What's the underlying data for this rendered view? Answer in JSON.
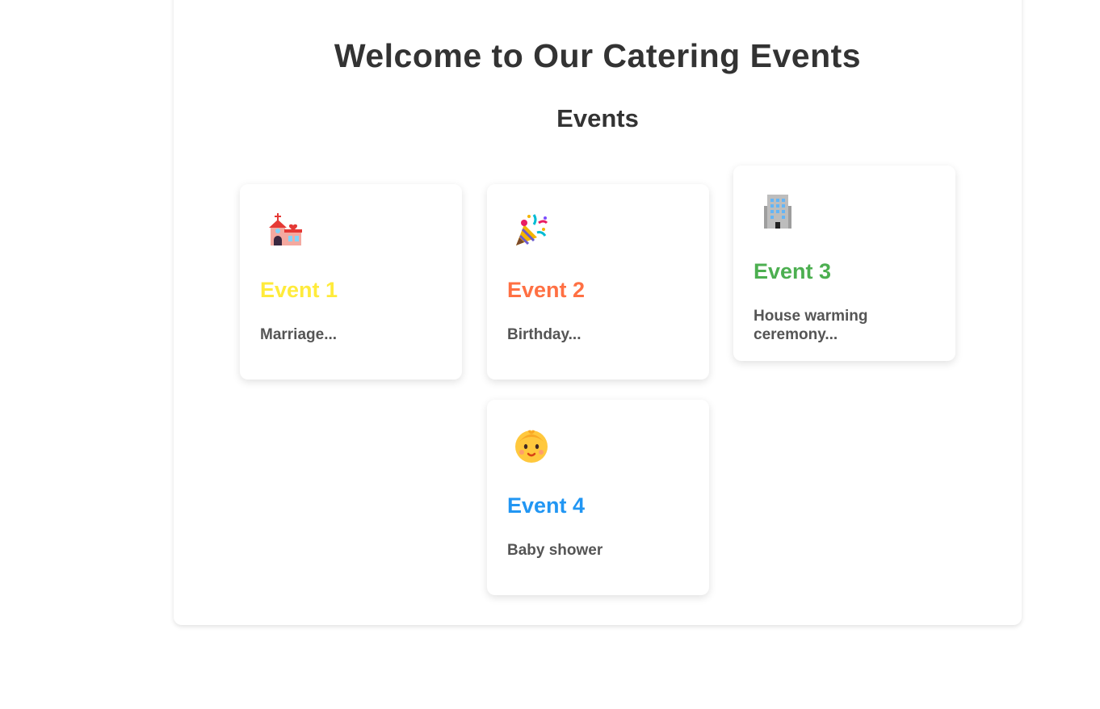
{
  "header": {
    "title": "Welcome to Our Catering Events",
    "subtitle": "Events"
  },
  "events": [
    {
      "icon": "wedding-chapel-icon",
      "title": "Event 1",
      "description": "Marriage...",
      "color": "#ffeb3b"
    },
    {
      "icon": "party-popper-icon",
      "title": "Event 2",
      "description": "Birthday...",
      "color": "#ff7043"
    },
    {
      "icon": "office-building-icon",
      "title": "Event 3",
      "description": "House warming ceremony...",
      "color": "#4caf50"
    },
    {
      "icon": "baby-icon",
      "title": "Event 4",
      "description": "Baby shower",
      "color": "#2196f3"
    }
  ]
}
